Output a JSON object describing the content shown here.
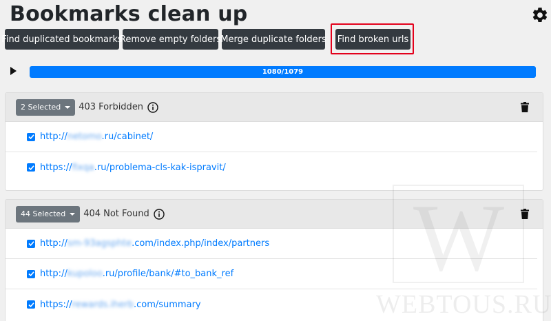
{
  "header": {
    "title": "Bookmarks clean up",
    "settings_icon": "gear-icon"
  },
  "toolbar": {
    "buttons": [
      {
        "label": "Find duplicated bookmarks"
      },
      {
        "label": "Remove empty folders"
      },
      {
        "label": "Merge duplicate folders"
      },
      {
        "label": "Find broken urls"
      }
    ]
  },
  "progress": {
    "label": "1080/1079",
    "fraction": 1.0,
    "color": "#007bff"
  },
  "groups": [
    {
      "selected_label": "2 Selected",
      "status": "403 Forbidden",
      "items": [
        {
          "prefix": "http://",
          "blurred": "netomo",
          "suffix": ".ru/cabinet/"
        },
        {
          "prefix": "https://",
          "blurred": "fixqa",
          "suffix": ".ru/problema-cls-kak-ispravit/"
        }
      ]
    },
    {
      "selected_label": "44 Selected",
      "status": "404 Not Found",
      "items": [
        {
          "prefix": "http://",
          "blurred": "sm-93agsphte",
          "suffix": ".com/index.php/index/partners"
        },
        {
          "prefix": "http://",
          "blurred": "kupoloo",
          "suffix": ".ru/profile/bank/#to_bank_ref"
        },
        {
          "prefix": "https://",
          "blurred": "rewards.iherb",
          "suffix": ".com/summary"
        }
      ]
    }
  ],
  "watermark": {
    "letter": "W",
    "text": "WEBTOUS.RU"
  },
  "colors": {
    "accent": "#007bff",
    "dark_button": "#343a40",
    "highlight": "#e3001b"
  }
}
